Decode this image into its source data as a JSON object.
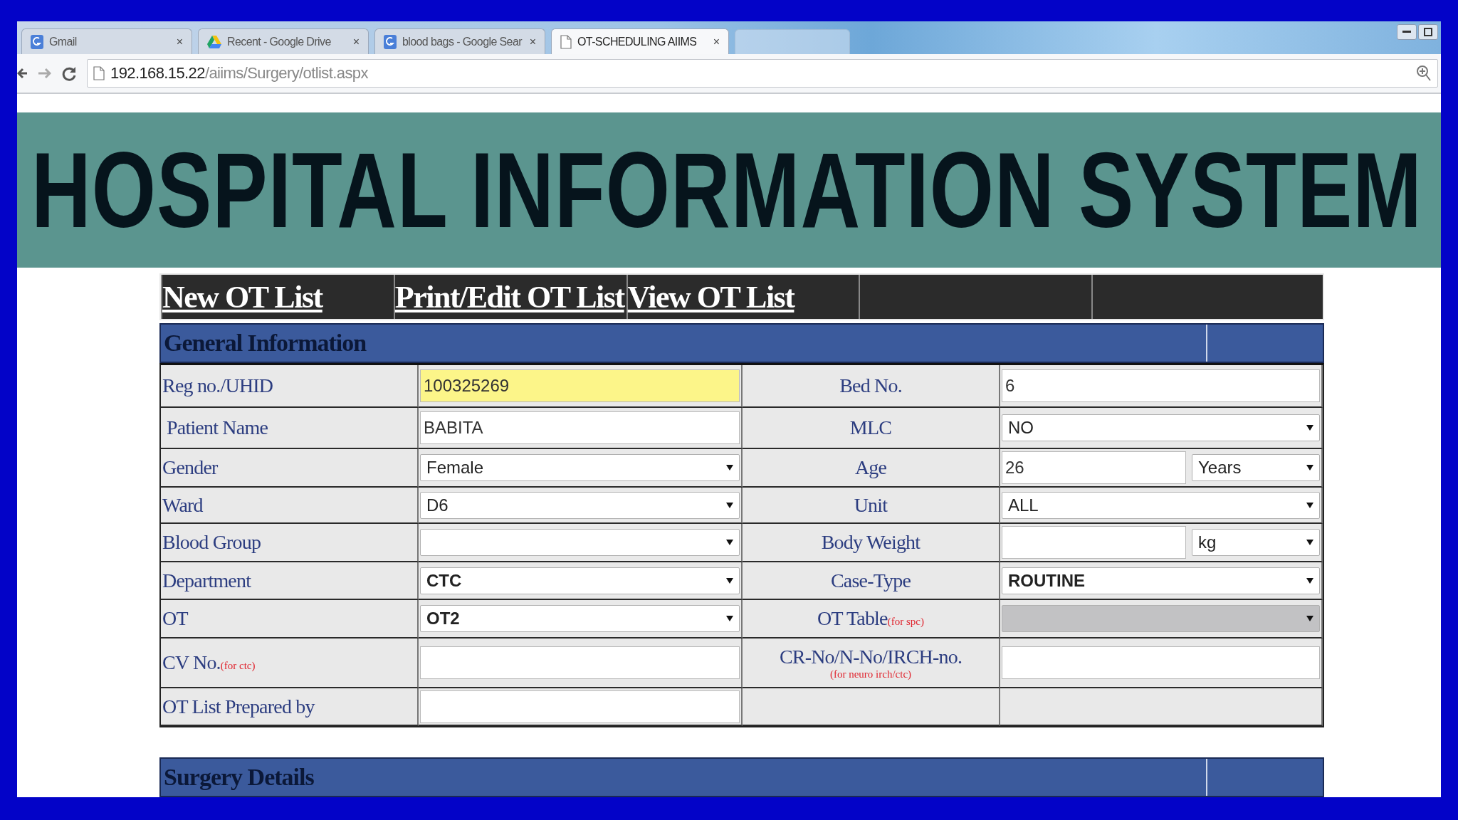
{
  "browser": {
    "tabs": [
      {
        "title": "Gmail",
        "kind": "google",
        "selected": false,
        "close": "×"
      },
      {
        "title": "Recent - Google Drive",
        "kind": "drive",
        "selected": false,
        "close": "×"
      },
      {
        "title": "blood bags - Google Sear",
        "kind": "google",
        "selected": false,
        "close": "×"
      },
      {
        "title": "OT-SCHEDULING AIIMS",
        "kind": "page",
        "selected": true,
        "close": "×"
      },
      {
        "kind": "blank",
        "selected": false
      }
    ],
    "url": {
      "host": "192.168.15.22",
      "path": "/aiims/Surgery/otlist.aspx"
    }
  },
  "banner": {
    "title": "HOSPITAL INFORMATION SYSTEM"
  },
  "nav": {
    "links": [
      "New OT List",
      "Print/Edit OT List",
      "View OT List"
    ]
  },
  "general_information": {
    "title": "General Information",
    "rows": [
      {
        "left": {
          "label": "Reg no./UHID",
          "fields": [
            {
              "kind": "text",
              "value": "100325269",
              "highlighted": true
            }
          ]
        },
        "right": {
          "label": "Bed No.",
          "fields": [
            {
              "kind": "text",
              "value": "6"
            }
          ]
        }
      },
      {
        "left": {
          "label": "Patient Name",
          "indent": true,
          "fields": [
            {
              "kind": "text",
              "value": "BABITA"
            }
          ]
        },
        "right": {
          "label": "MLC",
          "fields": [
            {
              "kind": "select",
              "value": "NO"
            }
          ]
        }
      },
      {
        "left": {
          "label": "Gender",
          "fields": [
            {
              "kind": "select",
              "value": "Female"
            }
          ]
        },
        "right": {
          "label": "Age",
          "fields": [
            {
              "kind": "text",
              "value": "26"
            },
            {
              "kind": "select",
              "value": "Years"
            }
          ]
        }
      },
      {
        "left": {
          "label": "Ward",
          "fields": [
            {
              "kind": "select",
              "value": "D6"
            }
          ]
        },
        "right": {
          "label": "Unit",
          "fields": [
            {
              "kind": "select",
              "value": "ALL"
            }
          ]
        }
      },
      {
        "left": {
          "label": "Blood Group",
          "fields": [
            {
              "kind": "select"
            }
          ]
        },
        "right": {
          "label": "Body Weight",
          "fields": [
            {
              "kind": "text"
            },
            {
              "kind": "select",
              "value": "kg"
            }
          ]
        }
      },
      {
        "left": {
          "label": "Department",
          "fields": [
            {
              "kind": "select",
              "value": "CTC",
              "bold": true
            }
          ]
        },
        "right": {
          "label": "Case-Type",
          "fields": [
            {
              "kind": "select",
              "value": "ROUTINE",
              "bold": true
            }
          ]
        }
      },
      {
        "left": {
          "label": "OT",
          "fields": [
            {
              "kind": "select",
              "value": "OT2",
              "bold": true
            }
          ]
        },
        "right": {
          "label": "OT Table",
          "note": "(for spc)",
          "fields": [
            {
              "kind": "select",
              "disabled": true
            }
          ]
        }
      },
      {
        "left": {
          "label": "CV No.",
          "note": "(for ctc)",
          "fields": [
            {
              "kind": "text"
            }
          ]
        },
        "right": {
          "label": "CR-No/N-No/IRCH-no.",
          "note": "(for neuro irch/ctc)",
          "fields": [
            {
              "kind": "text"
            }
          ]
        }
      },
      {
        "left": {
          "label": "OT List Prepared by",
          "fields": [
            {
              "kind": "text"
            }
          ]
        },
        "right": {}
      }
    ]
  },
  "surgery_details": {
    "title": "Surgery Details"
  }
}
